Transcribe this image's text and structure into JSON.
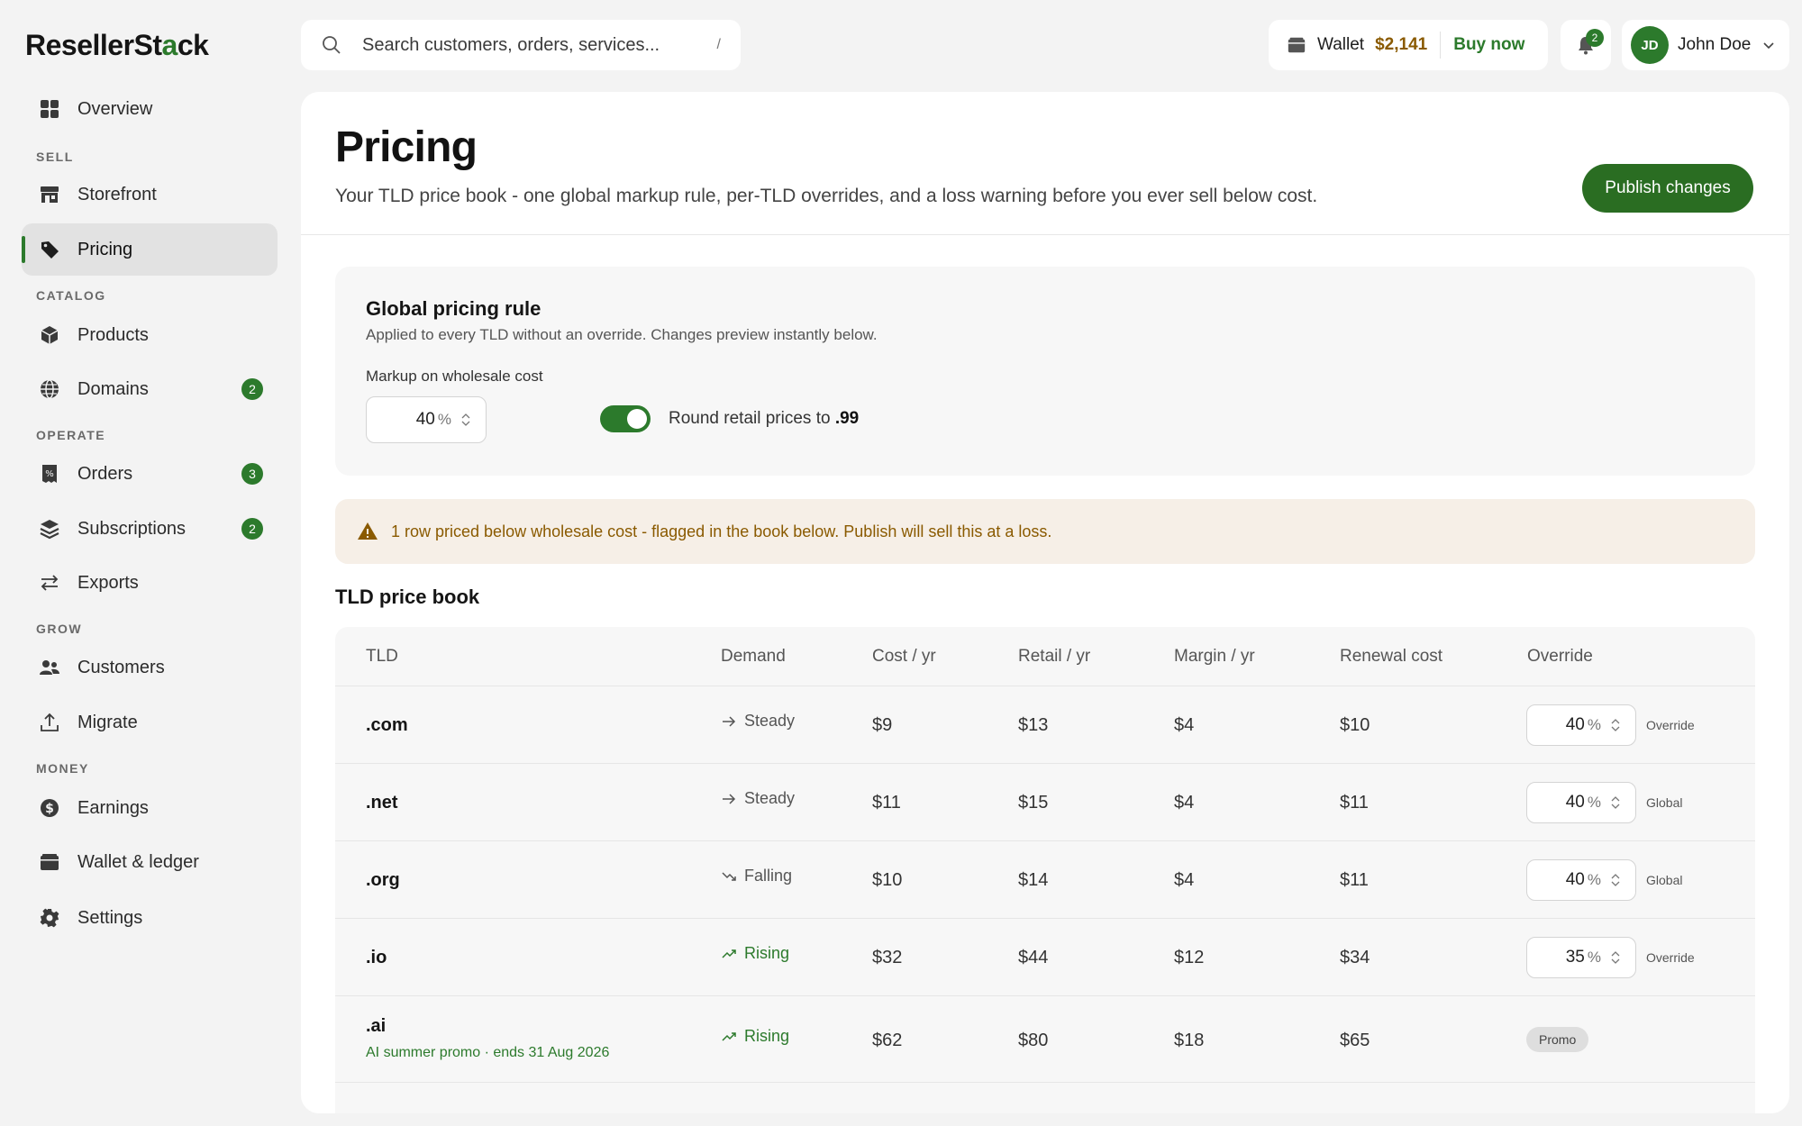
{
  "brand": {
    "name_part1": "ResellerSt",
    "name_mark": "a",
    "name_part2": "ck"
  },
  "sidebar": {
    "overview": "Overview",
    "sections": {
      "sell": "SELL",
      "catalog": "CATALOG",
      "operate": "OPERATE",
      "grow": "GROW",
      "money": "MONEY"
    },
    "items": {
      "storefront": "Storefront",
      "pricing": "Pricing",
      "products": "Products",
      "domains": {
        "label": "Domains",
        "badge": "2"
      },
      "orders": {
        "label": "Orders",
        "badge": "3"
      },
      "subscriptions": {
        "label": "Subscriptions",
        "badge": "2"
      },
      "exports": "Exports",
      "customers": "Customers",
      "migrate": "Migrate",
      "earnings": "Earnings",
      "wallet": "Wallet & ledger",
      "settings": "Settings"
    }
  },
  "topbar": {
    "search_placeholder": "Search customers, orders, services...",
    "search_shortcut": "/",
    "wallet_label": "Wallet",
    "wallet_amount": "$2,141",
    "buy_now": "Buy now",
    "notifications_count": "2",
    "user_initials": "JD",
    "user_name": "John Doe"
  },
  "page": {
    "title": "Pricing",
    "subtitle": "Your TLD price book - one global markup rule, per-TLD overrides, and a loss warning before you ever sell below cost.",
    "publish_label": "Publish changes"
  },
  "global_rule": {
    "title": "Global pricing rule",
    "subtitle": "Applied to every TLD without an override. Changes preview instantly below.",
    "markup_label": "Markup on wholesale cost",
    "markup_value": "40",
    "percent_sign": "%",
    "round_label": "Round retail prices to",
    "round_value": ".99",
    "round_enabled": true
  },
  "warning": {
    "text": "1 row priced below wholesale cost - flagged in the book below. Publish will sell this at a loss."
  },
  "price_book": {
    "title": "TLD price book",
    "columns": [
      "TLD",
      "Demand",
      "Cost / yr",
      "Retail / yr",
      "Margin / yr",
      "Renewal cost",
      "Override"
    ],
    "rows": [
      {
        "tld": ".com",
        "demand": "Steady",
        "cost": "$9",
        "retail": "$13",
        "margin": "$4",
        "renewal": "$10",
        "override": "40",
        "mode": "Override"
      },
      {
        "tld": ".net",
        "demand": "Steady",
        "cost": "$11",
        "retail": "$15",
        "margin": "$4",
        "renewal": "$11",
        "override": "40",
        "mode": "Global"
      },
      {
        "tld": ".org",
        "demand": "Falling",
        "cost": "$10",
        "retail": "$14",
        "margin": "$4",
        "renewal": "$11",
        "override": "40",
        "mode": "Global"
      },
      {
        "tld": ".io",
        "demand": "Rising",
        "cost": "$32",
        "retail": "$44",
        "margin": "$12",
        "renewal": "$34",
        "override": "35",
        "mode": "Override"
      },
      {
        "tld": ".ai",
        "note": "AI summer promo · ends 31 Aug 2026",
        "demand": "Rising",
        "cost": "$62",
        "retail": "$80",
        "margin": "$18",
        "renewal": "$65",
        "mode": "Promo"
      }
    ]
  },
  "colors": {
    "accent": "#2c7a2c",
    "warning_bg": "#f6efe7",
    "warning_text": "#8a5a00"
  }
}
